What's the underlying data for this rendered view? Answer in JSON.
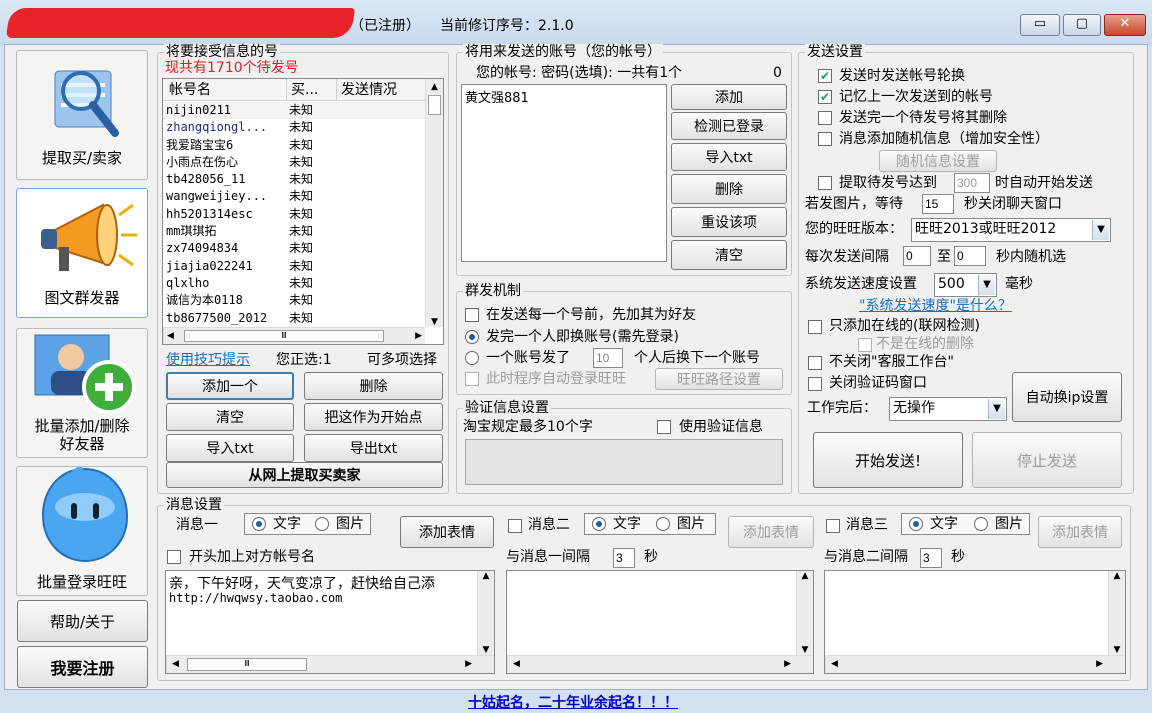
{
  "window": {
    "title_status": "（已注册）",
    "revision_label": "当前修订序号：2.1.0",
    "minimize": "▭",
    "maximize": "▢",
    "close": "✕"
  },
  "nav": [
    {
      "label": "提取买/卖家",
      "icon": "magnifier-icon"
    },
    {
      "label": "图文群发器",
      "icon": "megaphone-icon"
    },
    {
      "label": "批量添加/删除\n好友器",
      "icon": "add-user-icon"
    },
    {
      "label": "批量登录旺旺",
      "icon": "wangwang-icon"
    }
  ],
  "help_button": "帮助/关于",
  "register_button": "我要注册",
  "receivers": {
    "group_title": "将要接受信息的号",
    "count_text": "现共有1710个待发号",
    "columns": [
      "帐号名",
      "买...",
      "发送情况"
    ],
    "rows": [
      [
        "nijin0211",
        "未知",
        ""
      ],
      [
        "zhangqiongl...",
        "未知",
        ""
      ],
      [
        "我爱踏宝宝6",
        "未知",
        ""
      ],
      [
        "小雨点在伤心",
        "未知",
        ""
      ],
      [
        "tb428056_11",
        "未知",
        ""
      ],
      [
        "wangweijiey...",
        "未知",
        ""
      ],
      [
        "hh5201314esc",
        "未知",
        ""
      ],
      [
        "mm琪琪拓",
        "未知",
        ""
      ],
      [
        "zx74094834",
        "未知",
        ""
      ],
      [
        "jiajia022241",
        "未知",
        ""
      ],
      [
        "qlxlho",
        "未知",
        ""
      ],
      [
        "诚信为本0118",
        "未知",
        ""
      ],
      [
        "tb8677500_2012",
        "未知",
        ""
      ]
    ],
    "hint_link": "使用技巧提示",
    "selected_text": "您正选:1",
    "multi_text": "可多项选择",
    "add_one": "添加一个",
    "delete": "删除",
    "clear": "清空",
    "set_start": "把这作为开始点",
    "import": "导入txt",
    "export": "导出txt",
    "fetch_web": "从网上提取买卖家"
  },
  "senders": {
    "group_title": "将用来发送的账号（您的帐号）",
    "header_text": "您的帐号:  密码(选填):  一共有1个",
    "header_count": "0",
    "accounts": [
      "黄文强881"
    ],
    "buttons": [
      "添加",
      "检测已登录",
      "导入txt",
      "删除",
      "重设该项",
      "清空"
    ]
  },
  "mass": {
    "group_title": "群发机制",
    "opt1": "在发送每一个号前，先加其为好友",
    "opt2": "发完一个人即换账号(需先登录)",
    "opt3a": "一个账号发了",
    "opt3_value": "10",
    "opt3b": "个人后换下一个账号",
    "auto_login": "此时程序自动登录旺旺",
    "path_button": "旺旺路径设置"
  },
  "verify": {
    "group_title": "验证信息设置",
    "note": "淘宝规定最多10个字",
    "use_label": "使用验证信息"
  },
  "send": {
    "group_title": "发送设置",
    "cb1": "发送时发送帐号轮换",
    "cb2": "记忆上一次发送到的帐号",
    "cb3": "发送完一个待发号将其删除",
    "cb4": "消息添加随机信息（增加安全性）",
    "random_button": "随机信息设置",
    "fetch_a": "提取待发号达到",
    "fetch_value": "300",
    "fetch_b": "时自动开始发送",
    "img_a": "若发图片，等待",
    "img_value": "15",
    "img_b": "秒关闭聊天窗口",
    "ver_label": "您的旺旺版本：",
    "ver_value": "旺旺2013或旺旺2012",
    "interval_a": "每次发送间隔",
    "interval_min": "0",
    "interval_mid": "至",
    "interval_max": "0",
    "interval_b": "秒内随机选",
    "speed_label": "系统发送速度设置",
    "speed_value": "500",
    "speed_unit": "毫秒",
    "speed_link": "\"系统发送速度\"是什么？",
    "online_only": "只添加在线的(联网检测)",
    "delete_offline": "不是在线的删除",
    "no_close": "不关闭\"客服工作台\"",
    "close_captcha": "关闭验证码窗口",
    "auto_ip": "自动换ip设置",
    "after_label": "工作完后：",
    "after_value": "无操作",
    "start": "开始发送!",
    "stop": "停止发送"
  },
  "messages": {
    "group_title": "消息设置",
    "msg1": "消息一",
    "msg2": "消息二",
    "msg3": "消息三",
    "text": "文字",
    "image": "图片",
    "add_emoji": "添加表情",
    "prefix_label": "开头加上对方帐号名",
    "gap1_label": "与消息一间隔",
    "gap1_value": "3",
    "gap2_label": "与消息二间隔",
    "gap2_value": "3",
    "sec": "秒",
    "msg1_body": "亲，下午好呀，天气变凉了，赶快给自己添",
    "msg1_body2": "http://hwqwsy.taobao.com"
  },
  "footer_text": "十姑起名，二十年业余起名！！！"
}
